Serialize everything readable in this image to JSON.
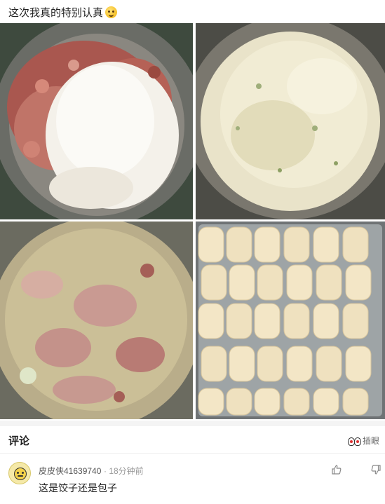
{
  "post": {
    "title": "这次我真的特别认真",
    "emoji_icon": "thinking-face-emoji"
  },
  "photos": [
    {
      "name": "photo-meat-and-cabbage"
    },
    {
      "name": "photo-chopped-cabbage"
    },
    {
      "name": "photo-mixed-filling"
    },
    {
      "name": "photo-dumplings-tray"
    }
  ],
  "comments_section": {
    "title": "评论",
    "insert_eye_label": "插眼",
    "insert_eye_icon": "eyes-icon"
  },
  "comments": [
    {
      "author": "皮皮侠41639740",
      "time": "· 18分钟前",
      "text": "这是饺子还是包子",
      "avatar_icon": "face-avatar",
      "like_icon": "thumbs-up-icon",
      "dislike_icon": "thumbs-down-icon"
    }
  ],
  "colors": {
    "text_primary": "#222222",
    "text_secondary": "#555555",
    "text_muted": "#999999",
    "divider": "#f4f4f4"
  }
}
